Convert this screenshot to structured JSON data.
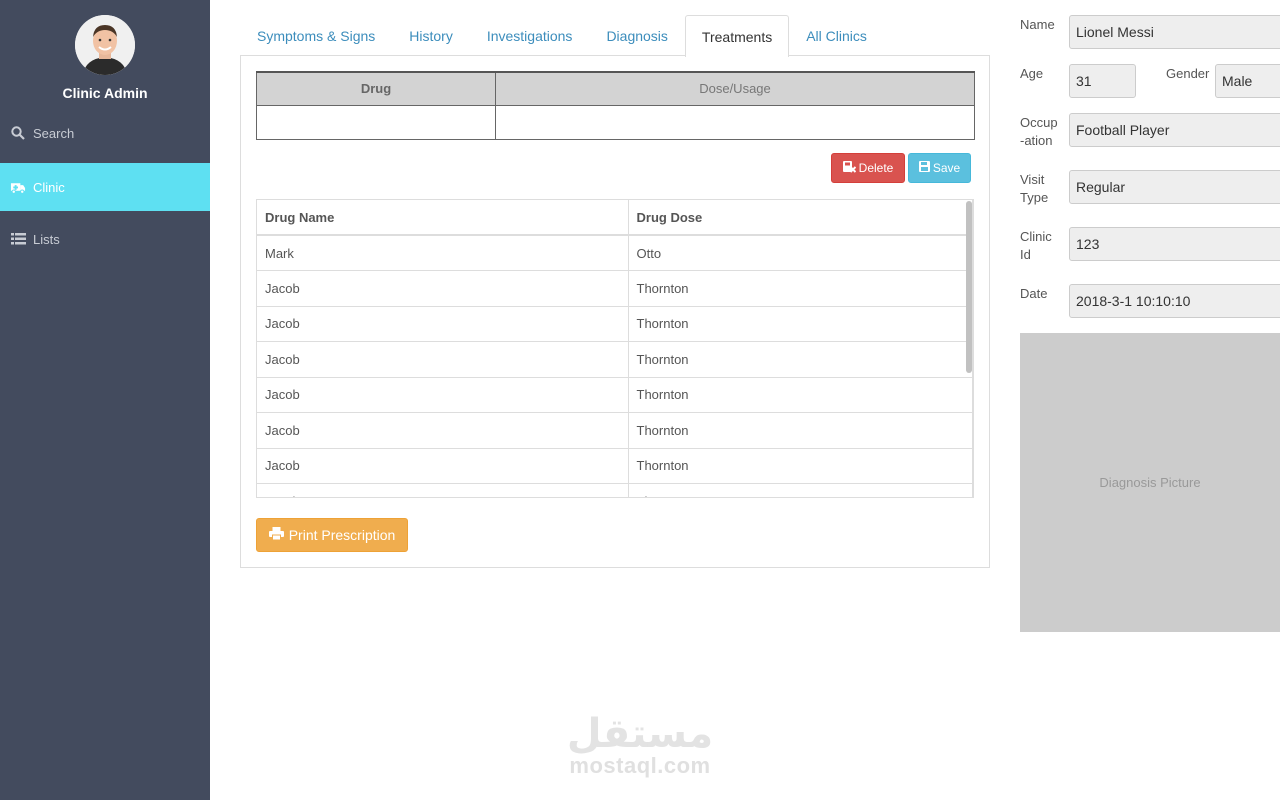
{
  "sidebar": {
    "admin_name": "Clinic Admin",
    "items": [
      {
        "label": "Search",
        "icon": "search-icon"
      },
      {
        "label": "Clinic",
        "icon": "ambulance-icon"
      },
      {
        "label": "Lists",
        "icon": "list-icon"
      }
    ],
    "active_item": "Clinic",
    "colors": {
      "bg": "#434b5e",
      "active": "#5ee0f2"
    }
  },
  "tabs": [
    {
      "label": "Symptoms & Signs"
    },
    {
      "label": "History"
    },
    {
      "label": "Investigations"
    },
    {
      "label": "Diagnosis"
    },
    {
      "label": "Treatments"
    },
    {
      "label": "All Clinics"
    }
  ],
  "active_tab": "Treatments",
  "entry_table": {
    "columns": [
      "Drug",
      "Dose/Usage"
    ],
    "drug_value": "",
    "dose_value": ""
  },
  "actions": {
    "delete_label": "Delete",
    "save_label": "Save",
    "print_label": "Print Prescription"
  },
  "drugs_table": {
    "columns": [
      "Drug Name",
      "Drug Dose"
    ],
    "rows": [
      [
        "Mark",
        "Otto"
      ],
      [
        "Jacob",
        "Thornton"
      ],
      [
        "Jacob",
        "Thornton"
      ],
      [
        "Jacob",
        "Thornton"
      ],
      [
        "Jacob",
        "Thornton"
      ],
      [
        "Jacob",
        "Thornton"
      ],
      [
        "Jacob",
        "Thornton"
      ],
      [
        "Jacob",
        "Thornton"
      ]
    ]
  },
  "patient": {
    "name_label": "Name",
    "name_value": "Lionel Messi",
    "age_label": "Age",
    "age_value": "31",
    "gender_label": "Gender",
    "gender_value": "Male",
    "occupation_label_1": "Occup",
    "occupation_label_2": "-ation",
    "occupation_value": "Football Player",
    "visit_label_1": "Visit",
    "visit_label_2": "Type",
    "visit_value": "Regular",
    "clinic_label_1": "Clinic",
    "clinic_label_2": "Id",
    "clinic_value": "123",
    "date_label": "Date",
    "date_value": "2018-3-1 10:10:10",
    "picture_label": "Diagnosis Picture"
  },
  "watermark": {
    "arabic": "مستقل",
    "text": "mostaql.com"
  },
  "colors": {
    "tab_link": "#3c8dbc",
    "delete": "#d9534f",
    "save": "#5bc0de",
    "print": "#f0ad4e"
  }
}
